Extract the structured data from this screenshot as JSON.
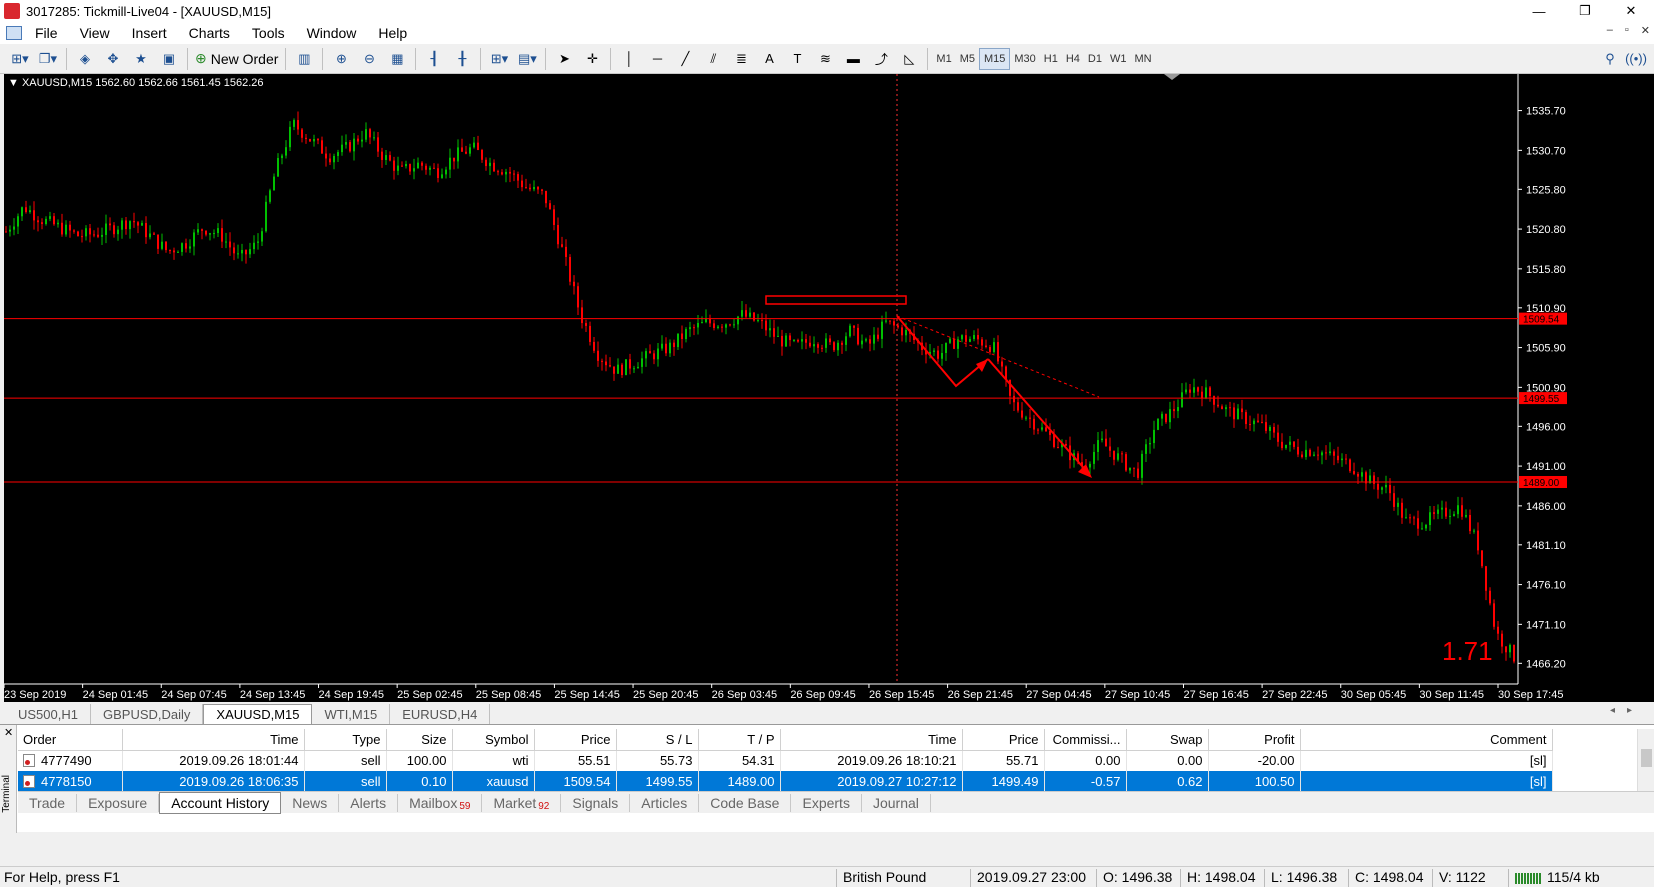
{
  "window": {
    "title": "3017285: Tickmill-Live04 - [XAUUSD,M15]",
    "min": "—",
    "max": "❐",
    "close": "✕"
  },
  "menu": [
    "File",
    "View",
    "Insert",
    "Charts",
    "Tools",
    "Window",
    "Help"
  ],
  "mdi": {
    "min": "–",
    "restore": "▫",
    "close": "✕"
  },
  "toolbar": {
    "new_order": "New Order",
    "timeframes": [
      "M1",
      "M5",
      "M15",
      "M30",
      "H1",
      "H4",
      "D1",
      "W1",
      "MN"
    ],
    "active_timeframe": "M15"
  },
  "chart_info": "▼ XAUUSD,M15  1562.60 1562.66 1561.45 1562.26",
  "chart_data": {
    "type": "candlestick",
    "symbol": "XAUUSD",
    "timeframe": "M15",
    "ohlc_label": "1562.60 1562.66 1561.45 1562.26",
    "y_ticks": [
      "1535.70",
      "1530.70",
      "1525.80",
      "1520.80",
      "1515.80",
      "1510.90",
      "1505.90",
      "1500.90",
      "1496.00",
      "1491.00",
      "1486.00",
      "1481.10",
      "1476.10",
      "1471.10",
      "1466.20"
    ],
    "ylim": [
      1463.6,
      1540.3
    ],
    "x_ticks": [
      "23 Sep 2019",
      "24 Sep 01:45",
      "24 Sep 07:45",
      "24 Sep 13:45",
      "24 Sep 19:45",
      "25 Sep 02:45",
      "25 Sep 08:45",
      "25 Sep 14:45",
      "25 Sep 20:45",
      "26 Sep 03:45",
      "26 Sep 09:45",
      "26 Sep 15:45",
      "26 Sep 21:45",
      "27 Sep 04:45",
      "27 Sep 10:45",
      "27 Sep 16:45",
      "27 Sep 22:45",
      "30 Sep 05:45",
      "30 Sep 11:45",
      "30 Sep 17:45"
    ],
    "price_path": [
      1520.5,
      1523.6,
      1522,
      1521,
      1520,
      1520.2,
      1521,
      1522,
      1520,
      1518,
      1519,
      1521,
      1520,
      1517,
      1519,
      1528,
      1534,
      1532,
      1530,
      1531,
      1533,
      1530,
      1528,
      1529,
      1528,
      1530,
      1531,
      1529,
      1528,
      1526,
      1525,
      1518,
      1510,
      1505,
      1503,
      1504,
      1505,
      1506,
      1508,
      1509,
      1509,
      1510,
      1509,
      1507,
      1506,
      1507,
      1506,
      1508,
      1506,
      1509,
      1508,
      1506,
      1505,
      1507,
      1507,
      1506,
      1499,
      1497,
      1495,
      1493,
      1491,
      1494,
      1492,
      1490,
      1496,
      1498,
      1501,
      1500,
      1498,
      1497,
      1496,
      1494,
      1493,
      1493,
      1492,
      1491,
      1489,
      1488,
      1484,
      1484,
      1485,
      1486,
      1481,
      1470,
      1467
    ],
    "horizontal_lines": [
      {
        "price": 1509.54,
        "label": "1509.54"
      },
      {
        "price": 1499.55,
        "label": "1499.55"
      },
      {
        "price": 1489.0,
        "label": "1489.00"
      }
    ],
    "annotation_text": "1.71",
    "colors": {
      "bull": "#00c000",
      "bear": "#ff0000",
      "background": "#000000",
      "axis_text": "#ffffff",
      "lines": "#ff0000",
      "annotation": "#ff0000"
    }
  },
  "chart_tabs": [
    "US500,H1",
    "GBPUSD,Daily",
    "XAUUSD,M15",
    "WTI,M15",
    "EURUSD,H4"
  ],
  "active_chart_tab": "XAUUSD,M15",
  "terminal": {
    "side_label": "Terminal",
    "columns": [
      "Order",
      "Time",
      "Type",
      "Size",
      "Symbol",
      "Price",
      "S / L",
      "T / P",
      "Time",
      "Price",
      "Commissi...",
      "Swap",
      "Profit",
      "Comment"
    ],
    "rows": [
      {
        "order": "4777490",
        "time": "2019.09.26 18:01:44",
        "type": "sell",
        "size": "100.00",
        "symbol": "wti",
        "price": "55.51",
        "sl": "55.73",
        "tp": "54.31",
        "close_time": "2019.09.26 18:10:21",
        "close_price": "55.71",
        "commission": "0.00",
        "swap": "0.00",
        "profit": "-20.00",
        "comment": "[sl]",
        "selected": false
      },
      {
        "order": "4778150",
        "time": "2019.09.26 18:06:35",
        "type": "sell",
        "size": "0.10",
        "symbol": "xauusd",
        "price": "1509.54",
        "sl": "1499.55",
        "tp": "1489.00",
        "close_time": "2019.09.27 10:27:12",
        "close_price": "1499.49",
        "commission": "-0.57",
        "swap": "0.62",
        "profit": "100.50",
        "comment": "[sl]",
        "selected": true
      }
    ],
    "tabs": [
      {
        "label": "Trade",
        "count": ""
      },
      {
        "label": "Exposure",
        "count": ""
      },
      {
        "label": "Account History",
        "count": ""
      },
      {
        "label": "News",
        "count": ""
      },
      {
        "label": "Alerts",
        "count": ""
      },
      {
        "label": "Mailbox",
        "count": "59"
      },
      {
        "label": "Market",
        "count": "92"
      },
      {
        "label": "Signals",
        "count": ""
      },
      {
        "label": "Articles",
        "count": ""
      },
      {
        "label": "Code Base",
        "count": ""
      },
      {
        "label": "Experts",
        "count": ""
      },
      {
        "label": "Journal",
        "count": ""
      }
    ],
    "active_tab": "Account History"
  },
  "status": {
    "help": "For Help, press F1",
    "profile": "British Pound",
    "datetime": "2019.09.27 23:00",
    "open": "O: 1496.38",
    "high": "H: 1498.04",
    "low": "L: 1496.38",
    "close": "C: 1498.04",
    "volume": "V: 1122",
    "traffic": "115/4 kb"
  }
}
